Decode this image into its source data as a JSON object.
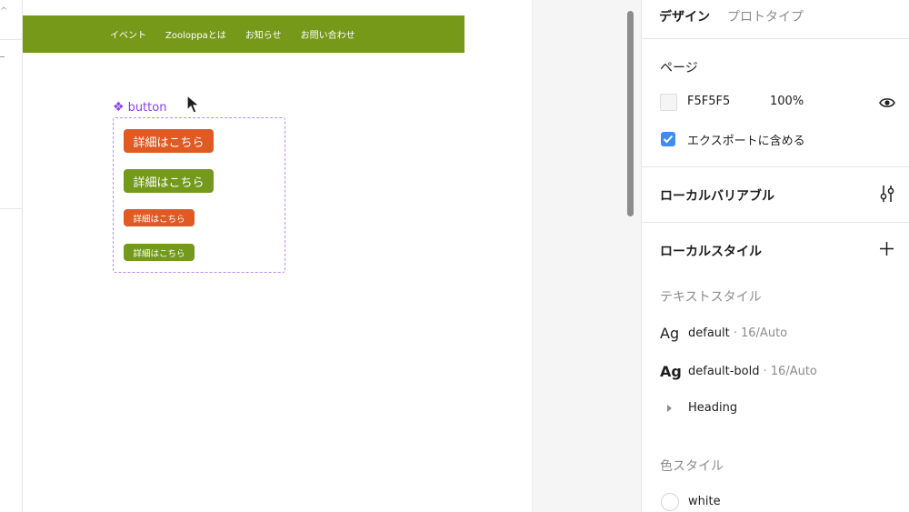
{
  "site_nav": {
    "items": [
      "イベント",
      "Zooloppaとは",
      "お知らせ",
      "お問い合わせ"
    ],
    "color": "#76991a"
  },
  "component": {
    "label": "button",
    "buttons": [
      {
        "label": "詳細はこちら",
        "color": "#e05a24",
        "size": "large"
      },
      {
        "label": "詳細はこちら",
        "color": "#73991d",
        "size": "large"
      },
      {
        "label": "詳細はこちら",
        "color": "#e05a24",
        "size": "small"
      },
      {
        "label": "詳細はこちら",
        "color": "#73991d",
        "size": "small"
      }
    ]
  },
  "panel": {
    "tabs": {
      "design": "デザイン",
      "prototype": "プロトタイプ"
    },
    "page_section": {
      "title": "ページ",
      "color_hex": "F5F5F5",
      "opacity": "100%",
      "export_label": "エクスポートに含める",
      "export_checked": true
    },
    "local_variables": {
      "title": "ローカルバリアブル"
    },
    "local_styles": {
      "title": "ローカルスタイル",
      "text_styles_label": "テキストスタイル",
      "text_styles": [
        {
          "sample": "Ag",
          "name": "default",
          "meta": "· 16/Auto"
        },
        {
          "sample": "Ag",
          "name": "default-bold",
          "meta": "· 16/Auto"
        }
      ],
      "heading_group": "Heading",
      "color_styles_label": "色スタイル",
      "color_styles": [
        {
          "name": "white",
          "color": "#ffffff"
        }
      ]
    }
  },
  "icons": [
    "eye-icon",
    "sliders-icon",
    "plus-icon",
    "check-icon",
    "cursor-icon",
    "component-icon",
    "caret-right-icon"
  ]
}
